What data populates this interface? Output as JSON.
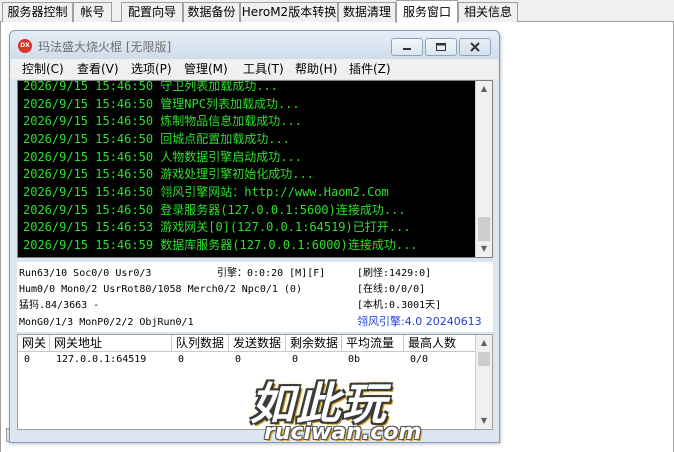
{
  "tabs": [
    {
      "label": "服务器控制",
      "active": false
    },
    {
      "label": "帐号",
      "active": false
    },
    {
      "label": "配置向导",
      "active": false
    },
    {
      "label": "数据备份",
      "active": false
    },
    {
      "label": "HeroM2版本转换",
      "active": false
    },
    {
      "label": "数据清理",
      "active": false
    },
    {
      "label": "服务窗口",
      "active": true
    },
    {
      "label": "相关信息",
      "active": false
    }
  ],
  "window": {
    "icon_text": "DX",
    "title": "玛法盛大烧火棍 [无限版]",
    "icons": {
      "minimize": "minimize-icon",
      "maximize": "maximize-icon",
      "close": "close-icon"
    }
  },
  "menu": [
    "控制(C)",
    "查看(V)",
    "选项(P)",
    "管理(M)",
    "工具(T)",
    "帮助(H)",
    "插件(Z)"
  ],
  "log": [
    "2026/9/15 15:46:50 守卫列表加载成功...",
    "2026/9/15 15:46:50 管理NPC列表加载成功...",
    "2026/9/15 15:46:50 炼制物品信息加载成功...",
    "2026/9/15 15:46:50 回城点配置加载成功...",
    "2026/9/15 15:46:50 人物数据引擎启动成功...",
    "2026/9/15 15:46:50 游戏处理引擎初始化成功...",
    "2026/9/15 15:46:50 翎风引擎网站：http://www.Haom2.Com",
    "2026/9/15 15:46:50 登录服务器(127.0.0.1:5600)连接成功...",
    "2026/9/15 15:46:53 游戏网关[0](127.0.0.1:64519)已打开...",
    "2026/9/15 15:46:59 数据库服务器(127.0.0.1:6000)连接成功..."
  ],
  "status": {
    "run": "Run63/10 Soc0/0 Usr0/3",
    "engine": "引擎：0:0:20 [M][F]",
    "refresh": "[刷怪:1429:0]",
    "hum": "Hum0/0 Mon0/2 UsrRot80/1058 Merch0/2 Npc0/1 (0)",
    "online": "[在线:0/0/0]",
    "monster": "猛犸.84/3663 -",
    "local": "[本机:0.3001天]",
    "mon_grid": "MonG0/1/3 MonP0/2/2 ObjRun0/1",
    "version": "翎风引擎:4.0 20240613"
  },
  "grid": {
    "headers": [
      "网关",
      "网关地址",
      "队列数据",
      "发送数据",
      "剩余数据",
      "平均流量",
      "最高人数"
    ],
    "rows": [
      [
        "0",
        "127.0.0.1:64519",
        "0",
        "0",
        "0",
        "0b",
        "0/0"
      ]
    ]
  },
  "watermark": {
    "main": "如此玩",
    "sub": "ruciwan.com"
  }
}
